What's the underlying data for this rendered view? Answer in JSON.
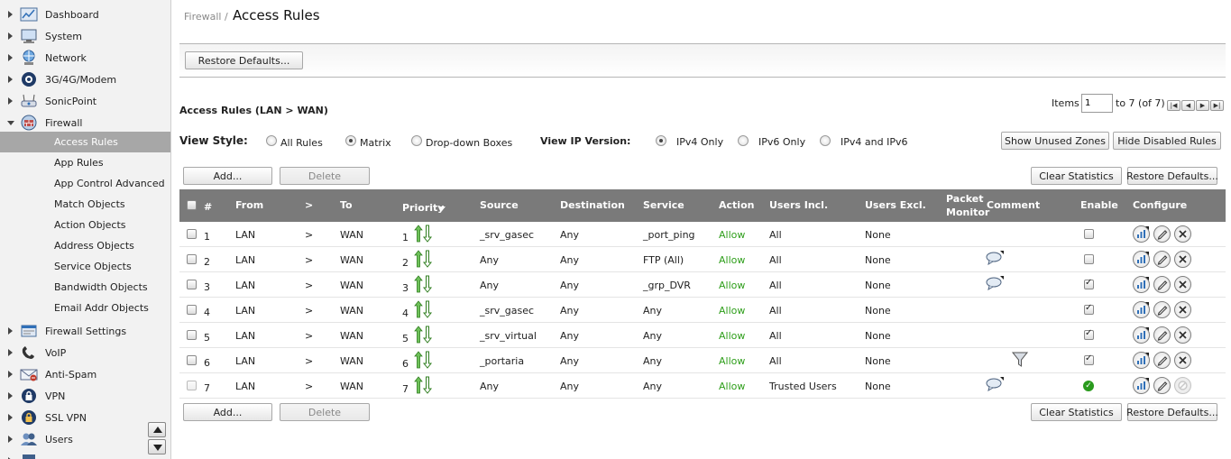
{
  "sidebar": {
    "items": [
      {
        "label": "Dashboard",
        "icon": "dashboard-icon"
      },
      {
        "label": "System",
        "icon": "system-icon"
      },
      {
        "label": "Network",
        "icon": "network-icon"
      },
      {
        "label": "3G/4G/Modem",
        "icon": "modem-icon"
      },
      {
        "label": "SonicPoint",
        "icon": "sonicpoint-icon"
      },
      {
        "label": "Firewall",
        "icon": "firewall-icon"
      }
    ],
    "firewall_sub": [
      "Access Rules",
      "App Rules",
      "App Control Advanced",
      "Match Objects",
      "Action Objects",
      "Address Objects",
      "Service Objects",
      "Bandwidth Objects",
      "Email Addr Objects"
    ],
    "items_after": [
      {
        "label": "Firewall Settings",
        "icon": "firewall-settings-icon"
      },
      {
        "label": "VoIP",
        "icon": "voip-icon"
      },
      {
        "label": "Anti-Spam",
        "icon": "anti-spam-icon"
      },
      {
        "label": "VPN",
        "icon": "vpn-icon"
      },
      {
        "label": "SSL VPN",
        "icon": "ssl-vpn-icon"
      },
      {
        "label": "Users",
        "icon": "users-icon"
      }
    ]
  },
  "header": {
    "breadcrumb": "Firewall /",
    "title": "Access Rules"
  },
  "toolbar": {
    "restore_defaults_top": "Restore Defaults..."
  },
  "section": {
    "title": "Access Rules (LAN > WAN)"
  },
  "pagination": {
    "items_label": "Items",
    "items_value": "1",
    "range_text": "to 7 (of 7)"
  },
  "view_style": {
    "label": "View Style:",
    "options": [
      "All Rules",
      "Matrix",
      "Drop-down Boxes"
    ],
    "selected": "Matrix"
  },
  "ip_version": {
    "label": "View IP Version:",
    "options": [
      "IPv4 Only",
      "IPv6 Only",
      "IPv4 and IPv6"
    ],
    "selected": "IPv4 Only"
  },
  "buttons": {
    "show_unused_zones": "Show Unused Zones",
    "hide_disabled_rules": "Hide Disabled Rules",
    "add": "Add...",
    "delete": "Delete",
    "clear_statistics": "Clear Statistics",
    "restore_defaults": "Restore Defaults..."
  },
  "table": {
    "headers": {
      "num": "#",
      "from": "From",
      "arrow": ">",
      "to": "To",
      "priority": "Priority",
      "source": "Source",
      "destination": "Destination",
      "service": "Service",
      "action": "Action",
      "users_incl": "Users Incl.",
      "users_excl": "Users Excl.",
      "packet_monitor_1": "Packet",
      "packet_monitor_2": "Monitor",
      "comment": "Comment",
      "enable": "Enable",
      "configure": "Configure"
    },
    "rows": [
      {
        "num": "1",
        "from": "LAN",
        "arrow": ">",
        "to": "WAN",
        "priority": "1",
        "source": "_srv_gasec",
        "destination": "Any",
        "service": "_port_ping",
        "action": "Allow",
        "users_incl": "All",
        "users_excl": "None",
        "comment": false,
        "packet_monitor": false,
        "enable": "unchecked",
        "deletable": true
      },
      {
        "num": "2",
        "from": "LAN",
        "arrow": ">",
        "to": "WAN",
        "priority": "2",
        "source": "Any",
        "destination": "Any",
        "service": "FTP (All)",
        "action": "Allow",
        "users_incl": "All",
        "users_excl": "None",
        "comment": true,
        "packet_monitor": false,
        "enable": "unchecked",
        "deletable": true
      },
      {
        "num": "3",
        "from": "LAN",
        "arrow": ">",
        "to": "WAN",
        "priority": "3",
        "source": "Any",
        "destination": "Any",
        "service": "_grp_DVR",
        "action": "Allow",
        "users_incl": "All",
        "users_excl": "None",
        "comment": true,
        "packet_monitor": false,
        "enable": "checked",
        "deletable": true
      },
      {
        "num": "4",
        "from": "LAN",
        "arrow": ">",
        "to": "WAN",
        "priority": "4",
        "source": "_srv_gasec",
        "destination": "Any",
        "service": "Any",
        "action": "Allow",
        "users_incl": "All",
        "users_excl": "None",
        "comment": false,
        "packet_monitor": false,
        "enable": "checked",
        "deletable": true
      },
      {
        "num": "5",
        "from": "LAN",
        "arrow": ">",
        "to": "WAN",
        "priority": "5",
        "source": "_srv_virtual",
        "destination": "Any",
        "service": "Any",
        "action": "Allow",
        "users_incl": "All",
        "users_excl": "None",
        "comment": false,
        "packet_monitor": false,
        "enable": "checked",
        "deletable": true
      },
      {
        "num": "6",
        "from": "LAN",
        "arrow": ">",
        "to": "WAN",
        "priority": "6",
        "source": "_portaria",
        "destination": "Any",
        "service": "Any",
        "action": "Allow",
        "users_incl": "All",
        "users_excl": "None",
        "comment": false,
        "packet_monitor": true,
        "enable": "checked",
        "deletable": true
      },
      {
        "num": "7",
        "from": "LAN",
        "arrow": ">",
        "to": "WAN",
        "priority": "7",
        "source": "Any",
        "destination": "Any",
        "service": "Any",
        "action": "Allow",
        "users_incl": "Trusted Users",
        "users_excl": "None",
        "comment": true,
        "packet_monitor": false,
        "enable": "default-on",
        "deletable": false
      }
    ]
  },
  "colors": {
    "allow": "#2e9e1a",
    "header_bg": "#7a7a7a",
    "active_nav": "#a7a7a7",
    "icon_blue": "#2f6fb7"
  }
}
